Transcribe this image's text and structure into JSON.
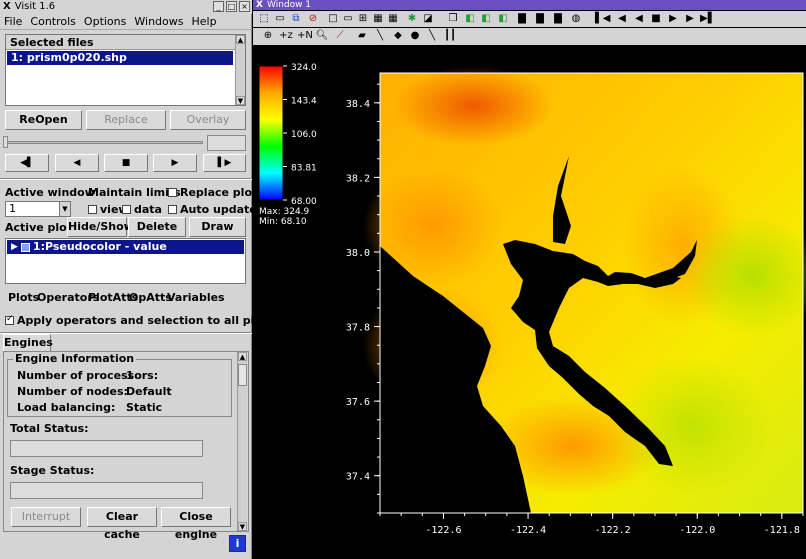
{
  "gui": {
    "title": "Visit 1.6",
    "menu": [
      "File",
      "Controls",
      "Options",
      "Windows",
      "Help"
    ],
    "selected_files_header": "Selected files",
    "selected_file": "1: prism0p020.shp",
    "reopen": "ReOpen",
    "replace": "Replace",
    "overlay": "Overlay",
    "active_window_label": "Active window",
    "active_window_value": "1",
    "maintain_limits": "Maintain limits",
    "view": "view",
    "data": "data",
    "replace_plots": "Replace plots",
    "auto_update": "Auto update",
    "active_plots": "Active plots",
    "hide_show": "Hide/Show",
    "delete": "Delete",
    "draw": "Draw",
    "plot_item": "1:Pseudocolor - value",
    "plot_menu": [
      "Plots",
      "Operators",
      "PlotAtts",
      "OpAtts",
      "Variables"
    ],
    "apply_ops": "Apply operators and selection to all plots",
    "engines_tab": "Engines",
    "engine_info": "Engine Information",
    "num_proc_label": "Number of processors:",
    "num_proc_value": "1",
    "num_nodes_label": "Number of nodes:",
    "num_nodes_value": "Default",
    "load_bal_label": "Load balancing:",
    "load_bal_value": "Static",
    "total_status": "Total Status:",
    "stage_status": "Stage Status:",
    "interrupt": "Interrupt",
    "clear_cache": "Clear cache",
    "close_engine": "Close engine"
  },
  "viz": {
    "title": "Window 1",
    "legend": {
      "ticks": [
        "324.0",
        "143.4",
        "106.0",
        "83.81",
        "68.00"
      ],
      "max_label": "Max:  324.9",
      "min_label": "Min:  68.10"
    }
  },
  "chart_data": {
    "type": "heatmap",
    "x_ticks": [
      "-122.6",
      "-122.4",
      "-122.2",
      "-122.0",
      "-121.8"
    ],
    "y_ticks": [
      "38.4",
      "38.2",
      "38.0",
      "37.8",
      "37.6",
      "37.4"
    ],
    "xlim": [
      -122.75,
      -121.75
    ],
    "ylim": [
      37.3,
      38.48
    ],
    "colorbar_range": [
      68.0,
      324.0
    ]
  },
  "colors": {
    "selection": "#0c168a",
    "viz_titlebar": "#6b4fc0",
    "panel": "#d4d4d4"
  }
}
